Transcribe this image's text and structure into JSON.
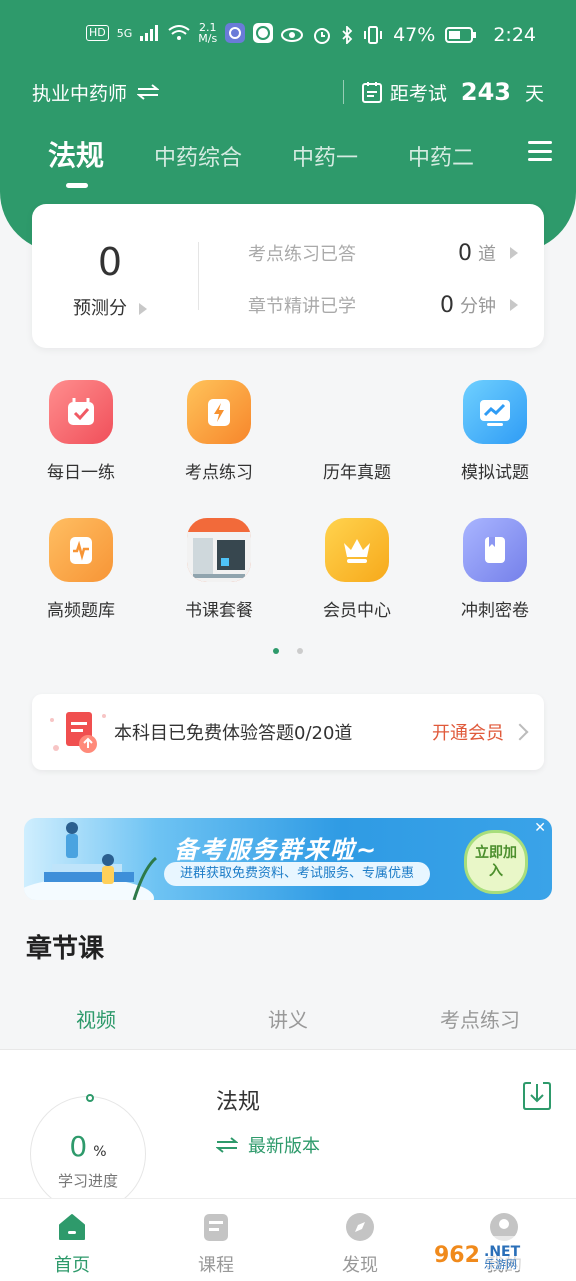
{
  "status_bar": {
    "network_tags": [
      "HD",
      "5G"
    ],
    "speed_value": "2.1",
    "speed_unit": "M/s",
    "battery": "47%",
    "time": "2:24"
  },
  "header": {
    "certificate": "执业中药师",
    "exam_prefix": "距考试",
    "exam_days": "243",
    "exam_suffix": "天"
  },
  "tabs": [
    {
      "label": "法规",
      "active": true
    },
    {
      "label": "中药综合",
      "active": false
    },
    {
      "label": "中药一",
      "active": false
    },
    {
      "label": "中药二",
      "active": false
    }
  ],
  "score_card": {
    "score": "0",
    "score_label": "预测分",
    "stats": [
      {
        "label": "考点练习已答",
        "value": "0",
        "unit": "道"
      },
      {
        "label": "章节精讲已学",
        "value": "0",
        "unit": "分钟"
      }
    ]
  },
  "grid": [
    {
      "label": "每日一练",
      "icon": "calendar-check-icon"
    },
    {
      "label": "考点练习",
      "icon": "lightning-icon"
    },
    {
      "label": "历年真题",
      "icon": "none"
    },
    {
      "label": "模拟试题",
      "icon": "monitor-chart-icon"
    },
    {
      "label": "高频题库",
      "icon": "scroll-pulse-icon"
    },
    {
      "label": "书课套餐",
      "icon": "book-package-icon"
    },
    {
      "label": "会员中心",
      "icon": "crown-icon"
    },
    {
      "label": "冲刺密卷",
      "icon": "bookmark-book-icon"
    }
  ],
  "trial": {
    "text": "本科目已免费体验答题0/20道",
    "link": "开通会员"
  },
  "banner": {
    "title": "备考服务群来啦~",
    "subtitle": "进群获取免费资料、考试服务、专属优惠",
    "button": "立即加入"
  },
  "section": {
    "title": "章节课",
    "sub_tabs": [
      {
        "label": "视频",
        "active": true
      },
      {
        "label": "讲义",
        "active": false
      },
      {
        "label": "考点练习",
        "active": false
      }
    ]
  },
  "course": {
    "progress_value": "0",
    "progress_unit": "%",
    "progress_label": "学习进度",
    "name": "法规",
    "version": "最新版本"
  },
  "bottom_nav": [
    {
      "label": "首页",
      "active": true
    },
    {
      "label": "课程",
      "active": false
    },
    {
      "label": "发现",
      "active": false
    },
    {
      "label": "我的",
      "active": false
    }
  ],
  "watermark": "962.NET 乐游网",
  "colors": {
    "primary": "#2e9a6b",
    "accent": "#e05a3b"
  }
}
